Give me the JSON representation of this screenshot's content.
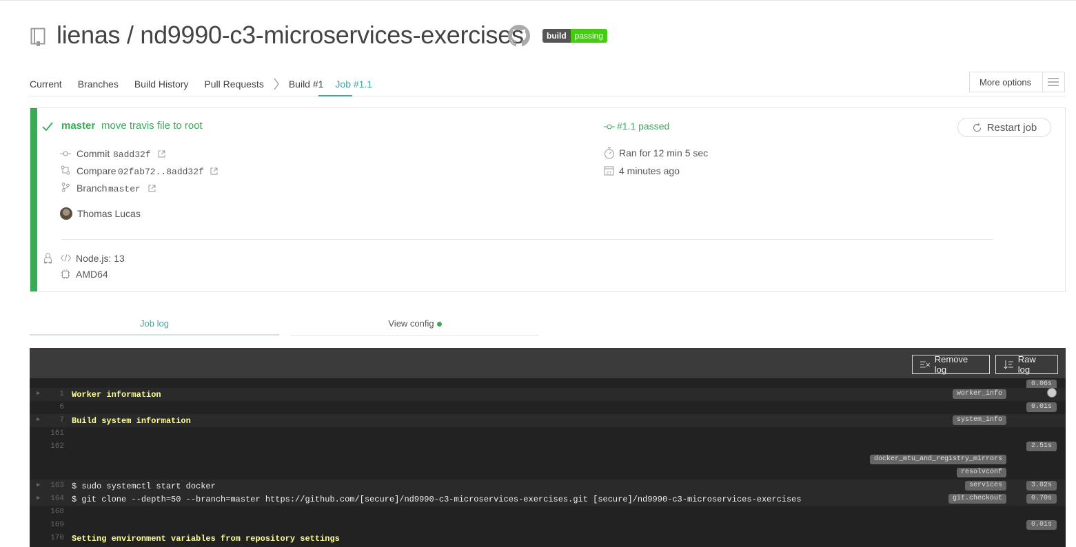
{
  "header": {
    "repo_title": "lienas / nd9990-c3-microservices-exercises",
    "badge_left": "build",
    "badge_right": "passing",
    "badge_color": "#44cc11"
  },
  "tabs": [
    {
      "label": "Current"
    },
    {
      "label": "Branches"
    },
    {
      "label": "Build History"
    },
    {
      "label": "Pull Requests"
    },
    {
      "label": "Build #1"
    },
    {
      "label": "Job #1.1"
    }
  ],
  "more_options": "More options",
  "job": {
    "branch": "master",
    "message": "move travis file to root",
    "status": "#1.1 passed",
    "restart_label": "Restart job",
    "commit_label": "Commit",
    "commit_value": "8add32f",
    "compare_label": "Compare",
    "compare_value": "02fab72..8add32f",
    "branch_label": "Branch",
    "branch_value": "master",
    "duration": "Ran for 12 min 5 sec",
    "finished": "4 minutes ago",
    "author": "Thomas Lucas",
    "language": "Node.js: 13",
    "arch": "AMD64",
    "accent_color": "#39aa56"
  },
  "log_tabs": {
    "job_log": "Job log",
    "view_config": "View config"
  },
  "log_buttons": {
    "remove": "Remove log",
    "raw": "Raw log"
  },
  "log": {
    "top_duration": "0.06s",
    "lines": [
      {
        "num": "1",
        "text": "Worker information",
        "tag": "worker_info",
        "duration": ""
      },
      {
        "num": "6",
        "text": "",
        "tag": "",
        "duration": "0.01s"
      },
      {
        "num": "7",
        "text": "Build system information",
        "tag": "system_info",
        "duration": ""
      },
      {
        "num": "161",
        "text": "",
        "tag": "",
        "duration": ""
      },
      {
        "num": "162",
        "text": "",
        "tag": "",
        "duration": "2.51s"
      },
      {
        "num": "",
        "text": "",
        "tag": "docker_mtu_and_registry_mirrors",
        "duration": ""
      },
      {
        "num": "",
        "text": "",
        "tag": "resolvconf",
        "duration": ""
      },
      {
        "num": "163",
        "text": "$ sudo systemctl start docker",
        "tag": "services",
        "duration": "3.02s"
      },
      {
        "num": "164",
        "text": "$ git clone --depth=50 --branch=master https://github.com/[secure]/nd9990-c3-microservices-exercises.git [secure]/nd9990-c3-microservices-exercises",
        "tag": "git.checkout",
        "duration": "0.70s"
      },
      {
        "num": "168",
        "text": "",
        "tag": "",
        "duration": ""
      },
      {
        "num": "169",
        "text": "",
        "tag": "",
        "duration": "0.01s"
      },
      {
        "num": "170",
        "text": "Setting environment variables from repository settings",
        "tag": "",
        "duration": ""
      }
    ]
  }
}
